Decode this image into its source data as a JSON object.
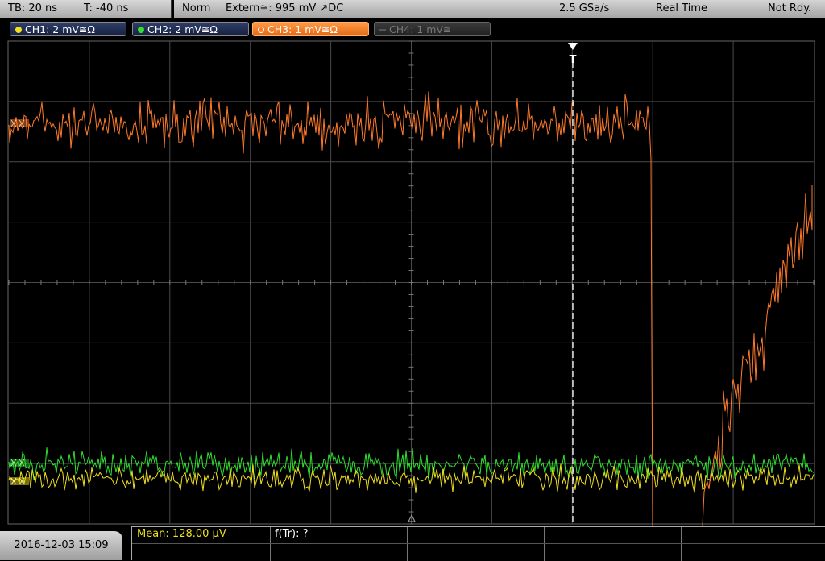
{
  "status_bar": {
    "timebase": "TB: 20 ns",
    "trigger_offset": "T: -40 ns",
    "trigger_mode": "Norm",
    "trigger_source": "Extern≅: 995 mV ↗DC",
    "sample_rate": "2.5 GSa/s",
    "acq_mode": "Real Time",
    "state": "Not Rdy."
  },
  "channels": [
    {
      "label": "CH1: 2 mV≅Ω",
      "color": "#f0e020",
      "active": true
    },
    {
      "label": "CH2: 2 mV≅Ω",
      "color": "#30e030",
      "active": true
    },
    {
      "label": "CH3: 1 mV≅Ω",
      "color": "#ff7a2a",
      "active": true
    },
    {
      "label": "CH4: 1 mV≅",
      "color": "#777777",
      "active": false
    }
  ],
  "measurements": {
    "mean": "Mean: 128.00 µV",
    "freq": "f(Tr): ?"
  },
  "datetime": "2016-12-03 15:09",
  "colors": {
    "ch1": "#f0e020",
    "ch2": "#30e030",
    "ch3": "#ff7a2a",
    "grid": "#4a4a4a",
    "trigger_line": "#ffffff"
  }
}
